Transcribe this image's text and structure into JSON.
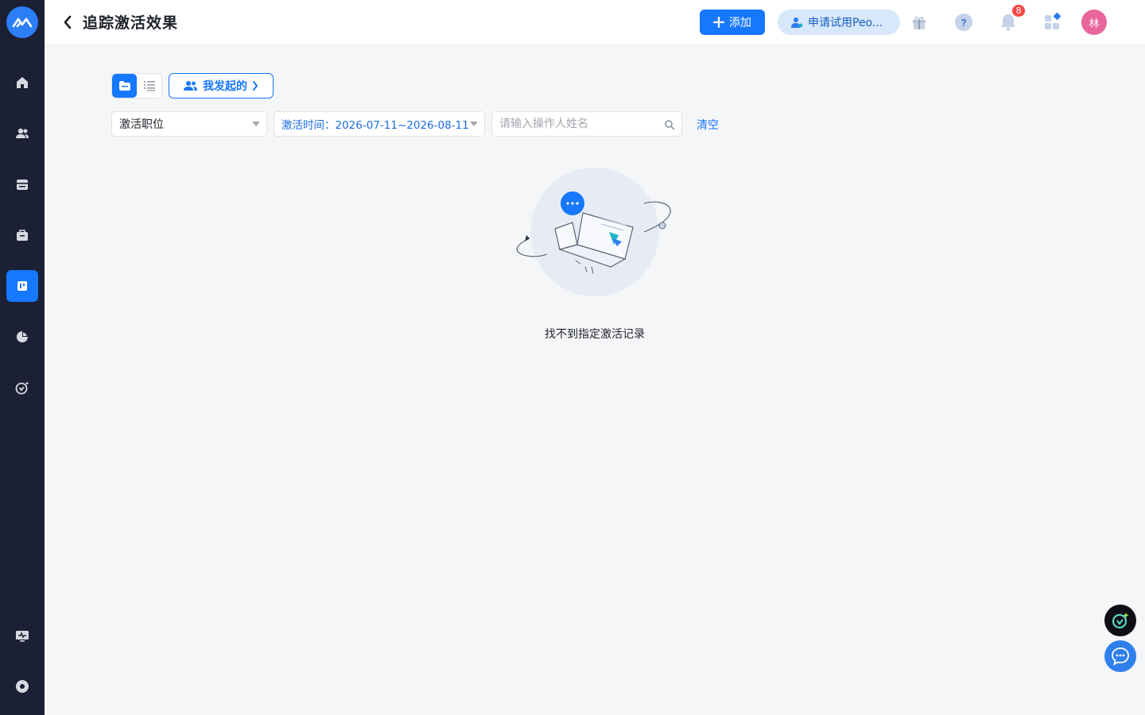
{
  "header": {
    "title": "追踪激活效果",
    "add_label": "添加",
    "trial_label": "申请试用Peo...",
    "notification_count": "8",
    "avatar_text": "林"
  },
  "toolbar": {
    "mine_label": "我发起的",
    "position_select": "激活职位",
    "time_select": "激活时间：2026-07-11~2026-08-11",
    "operator_placeholder": "请输入操作人姓名",
    "clear_label": "清空"
  },
  "empty_state": {
    "message": "找不到指定激活记录"
  },
  "colors": {
    "sidebar_bg": "#1b2034",
    "primary": "#1677ff",
    "badge": "#f54a45",
    "avatar": "#e8669b"
  }
}
